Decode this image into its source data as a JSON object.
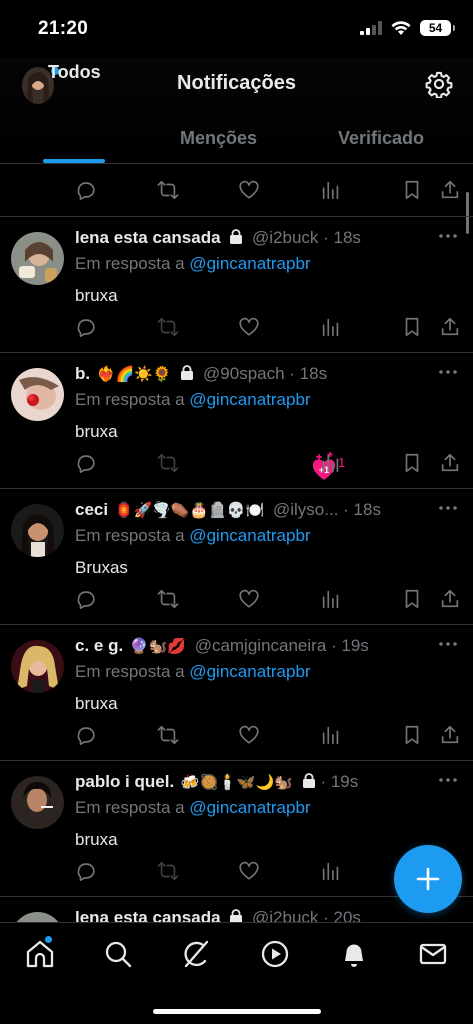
{
  "status_bar": {
    "time": "21:20",
    "battery": "54"
  },
  "header": {
    "title": "Notificações"
  },
  "tabs": [
    {
      "label": "Todos",
      "active": true
    },
    {
      "label": "Menções",
      "active": false
    },
    {
      "label": "Verificado",
      "active": false
    }
  ],
  "reply_prefix": "Em resposta a",
  "tweets": [
    {
      "name": "lena esta cansada",
      "emoji": "",
      "locked": true,
      "handle": "@i2buck",
      "time": "· 18s",
      "reply_to": "@gincanatrapbr",
      "text": "bruxa"
    },
    {
      "name": "b.",
      "emoji": "❤️‍🔥🌈☀️🌻",
      "locked": true,
      "handle": "@90spach",
      "time": "· 18s",
      "reply_to": "@gincanatrapbr",
      "text": "bruxa",
      "like_count": "1"
    },
    {
      "name": "ceci",
      "emoji": "🏮🚀🌪️⚰️🎂🪦💀🍽️",
      "locked": false,
      "handle": "@ilyso...",
      "time": "· 18s",
      "reply_to": "@gincanatrapbr",
      "text": "Bruxas"
    },
    {
      "name": "c. e g.",
      "emoji": "🔮🐿️💋",
      "locked": false,
      "handle": "@camjgincaneira",
      "time": "· 19s",
      "reply_to": "@gincanatrapbr",
      "text": "bruxa"
    },
    {
      "name": "pablo i quel.",
      "emoji": "🍻🥘🕯️🦋🌙🐿️",
      "locked": true,
      "handle": "",
      "time": "· 19s",
      "reply_to": "@gincanatrapbr",
      "text": "bruxa"
    },
    {
      "name": "lena esta cansada",
      "emoji": "",
      "locked": true,
      "handle": "@i2buck",
      "time": "· 20s"
    }
  ],
  "colors": {
    "accent": "#1d9bf0",
    "background": "#000000",
    "secondary_text": "#71767b",
    "like": "#f91880"
  }
}
